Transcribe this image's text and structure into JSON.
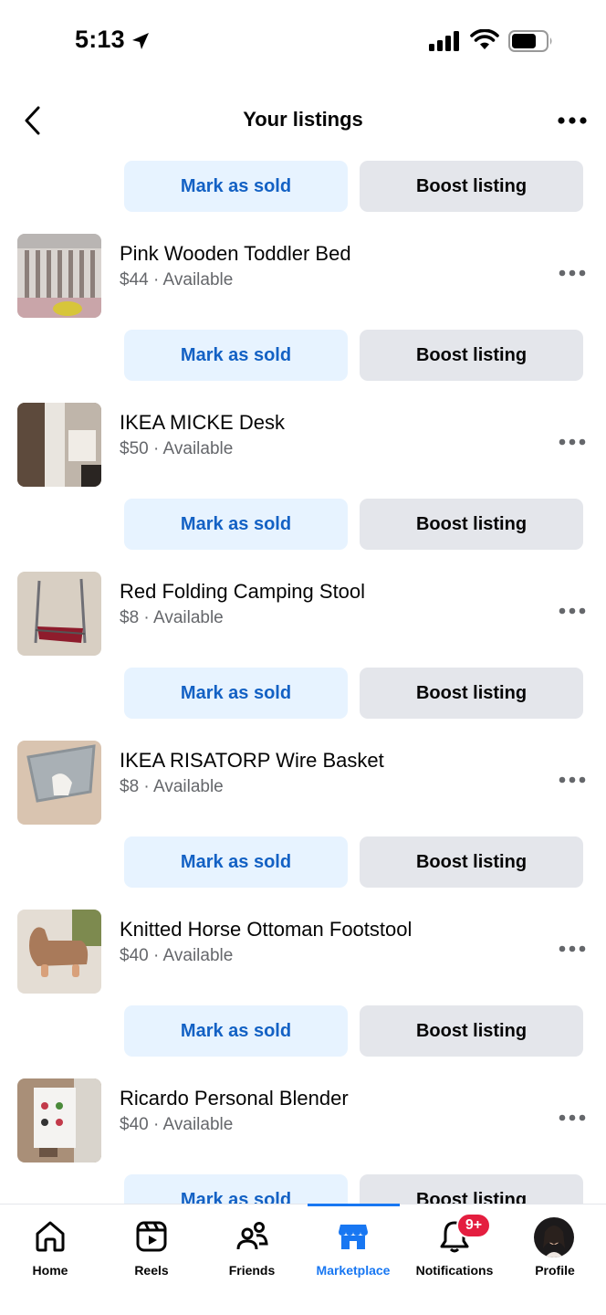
{
  "status_bar": {
    "time": "5:13"
  },
  "header": {
    "title": "Your listings"
  },
  "listings": [
    {
      "title": "",
      "price": "",
      "status": "",
      "sold_label": "Mark as sold",
      "boost_label": "Boost listing"
    },
    {
      "title": "Pink Wooden Toddler Bed",
      "price": "$44",
      "status": "Available",
      "sold_label": "Mark as sold",
      "boost_label": "Boost listing"
    },
    {
      "title": "IKEA MICKE Desk",
      "price": "$50",
      "status": "Available",
      "sold_label": "Mark as sold",
      "boost_label": "Boost listing"
    },
    {
      "title": "Red Folding Camping Stool",
      "price": "$8",
      "status": "Available",
      "sold_label": "Mark as sold",
      "boost_label": "Boost listing"
    },
    {
      "title": "IKEA RISATORP Wire Basket",
      "price": "$8",
      "status": "Available",
      "sold_label": "Mark as sold",
      "boost_label": "Boost listing"
    },
    {
      "title": "Knitted Horse Ottoman Footstool",
      "price": "$40",
      "status": "Available",
      "sold_label": "Mark as sold",
      "boost_label": "Boost listing"
    },
    {
      "title": "Ricardo Personal Blender",
      "price": "$40",
      "status": "Available",
      "sold_label": "Mark as sold",
      "boost_label": "Boost listing"
    }
  ],
  "separator": "·",
  "bottom_nav": {
    "items": [
      {
        "label": "Home",
        "icon": "home-icon"
      },
      {
        "label": "Reels",
        "icon": "reels-icon"
      },
      {
        "label": "Friends",
        "icon": "friends-icon"
      },
      {
        "label": "Marketplace",
        "icon": "marketplace-icon",
        "active": true
      },
      {
        "label": "Notifications",
        "icon": "bell-icon"
      },
      {
        "label": "Profile",
        "icon": "avatar"
      }
    ],
    "notifications_badge": "9+"
  },
  "colors": {
    "accent": "#1877f2",
    "sold_bg": "#e7f3ff",
    "sold_text": "#1361c4",
    "boost_bg": "#e4e6eb",
    "badge": "#e41e3f"
  }
}
